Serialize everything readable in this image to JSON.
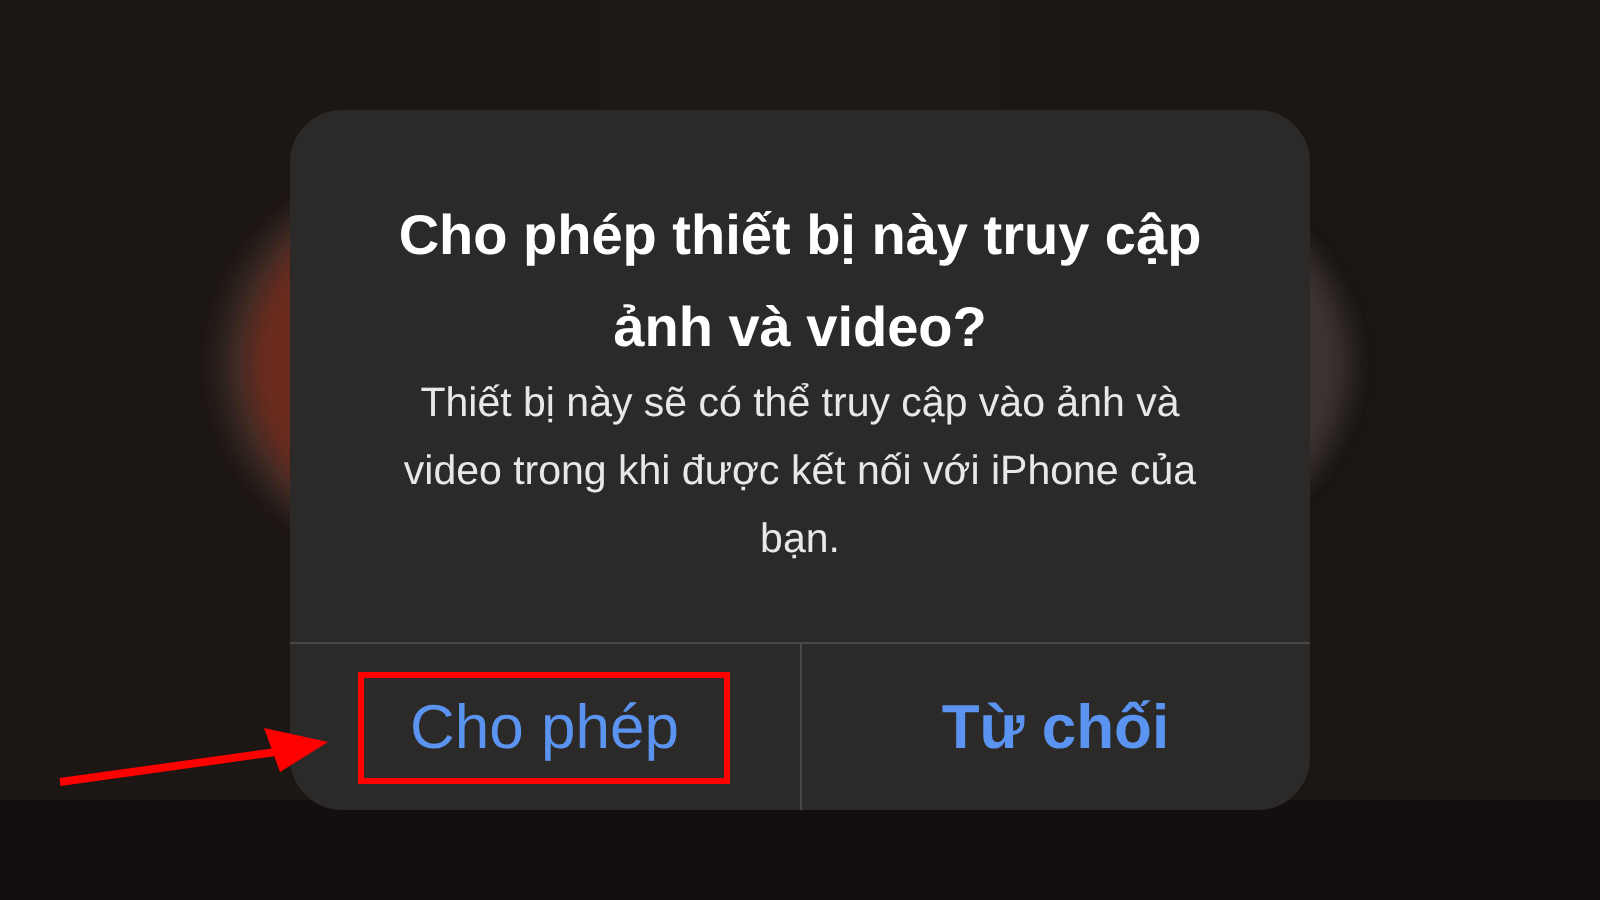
{
  "alert": {
    "title": "Cho phép thiết bị này truy cập ảnh và video?",
    "message": "Thiết bị này sẽ có thể truy cập vào ảnh và video trong khi được kết nối với iPhone của bạn.",
    "buttons": [
      {
        "label": "Cho phép",
        "kind": "default",
        "annotated": true
      },
      {
        "label": "Từ chối",
        "kind": "preferred",
        "annotated": false
      }
    ]
  }
}
